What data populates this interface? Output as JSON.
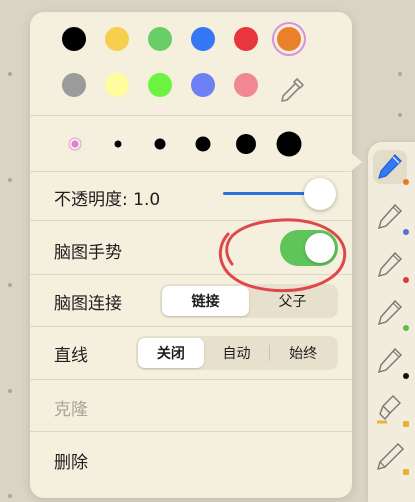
{
  "colors": {
    "row1": [
      "#000000",
      "#f6d04d",
      "#69ce68",
      "#3478f6",
      "#e9353c",
      "#ea7f2c"
    ],
    "row2": [
      "#9b9b9b",
      "#fffc9e",
      "#6cf442",
      "#6d80f5",
      "#f18791"
    ],
    "selected_index": 5
  },
  "sizes": {
    "selected_color": "#d676d6"
  },
  "opacity": {
    "label": "不透明度: 1.0",
    "value": 1.0
  },
  "mindmap_gesture": {
    "label": "脑图手势",
    "enabled": true
  },
  "mindmap_connect": {
    "label": "脑图连接",
    "options": [
      "链接",
      "父子"
    ],
    "selected": 0
  },
  "straight_line": {
    "label": "直线",
    "options": [
      "关闭",
      "自动",
      "始终"
    ],
    "selected": 0
  },
  "clone": {
    "label": "克隆",
    "enabled": false
  },
  "delete": {
    "label": "删除"
  },
  "toolbar": {
    "tools": [
      {
        "icon": "pen-icon",
        "color": "#e07a2e",
        "active": true
      },
      {
        "icon": "pen-icon",
        "color": "#5a6ed8",
        "active": false
      },
      {
        "icon": "pen-icon",
        "color": "#e2363a",
        "active": false
      },
      {
        "icon": "pen-icon",
        "color": "#5bbf4e",
        "active": false
      },
      {
        "icon": "pen-icon",
        "color": "#111111",
        "active": false
      },
      {
        "icon": "highlighter-icon",
        "color": "#e8b437",
        "active": false
      },
      {
        "icon": "pencil-icon",
        "color": "#e8b437",
        "active": false
      }
    ]
  }
}
